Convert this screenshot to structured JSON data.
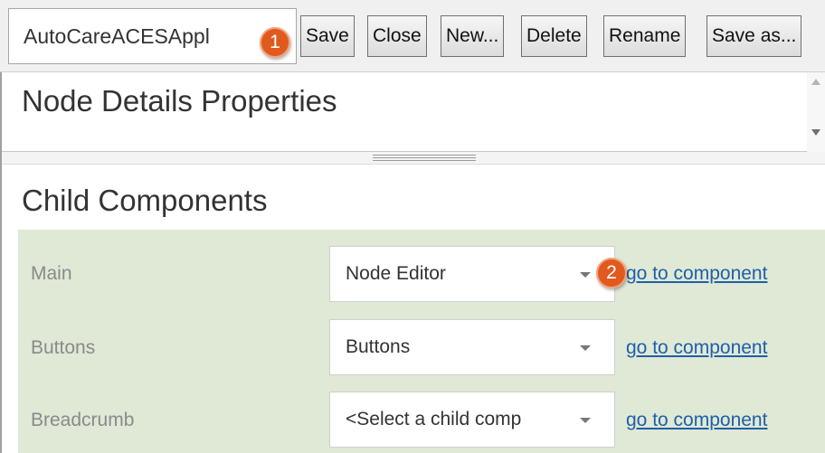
{
  "toolbar": {
    "name_value": "AutoCareACESAppl",
    "save_label": "Save",
    "close_label": "Close",
    "new_label": "New...",
    "delete_label": "Delete",
    "rename_label": "Rename",
    "save_as_label": "Save as..."
  },
  "badges": {
    "one": "1",
    "two": "2"
  },
  "details": {
    "title": "Node Details Properties"
  },
  "child_components": {
    "title": "Child Components",
    "rows": [
      {
        "label": "Main",
        "value": "Node Editor",
        "link": "go to component"
      },
      {
        "label": "Buttons",
        "value": "Buttons",
        "link": "go to component"
      },
      {
        "label": "Breadcrumb",
        "value": "<Select a child comp",
        "link": "go to component"
      }
    ]
  },
  "colors": {
    "panel_bg": "#dfe9d6",
    "badge": "#e05a1f",
    "link": "#1f5fa8"
  }
}
